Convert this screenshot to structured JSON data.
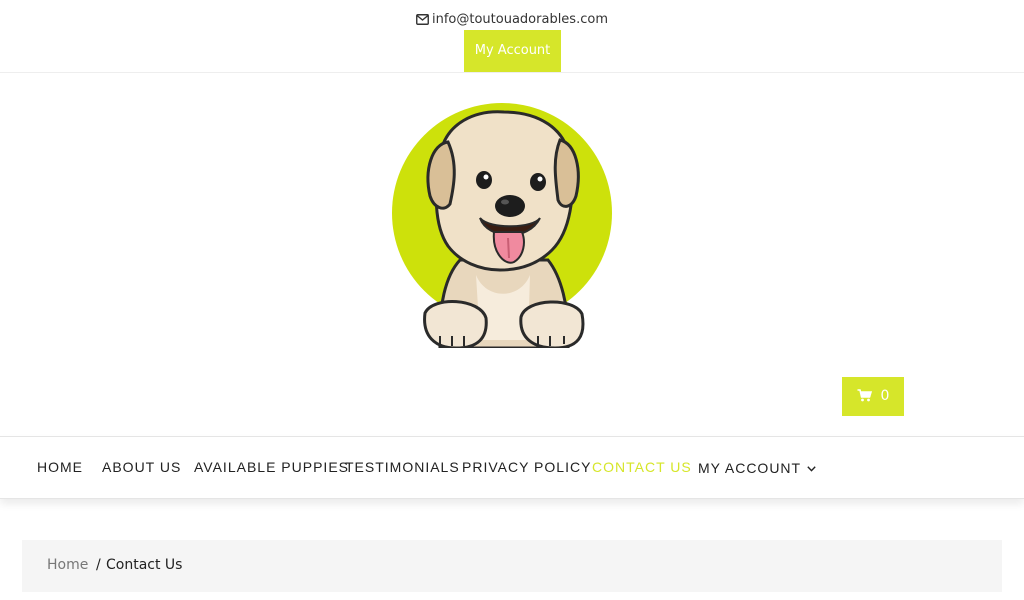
{
  "topbar": {
    "email": "info@toutouadorables.com",
    "account_label": "My Account"
  },
  "cart": {
    "count": "0"
  },
  "nav": {
    "items": [
      {
        "label": "HOME"
      },
      {
        "label": "ABOUT US"
      },
      {
        "label": "AVAILABLE PUPPIES"
      },
      {
        "label": "TESTIMONIALS"
      },
      {
        "label": "PRIVACY POLICY"
      },
      {
        "label": "CONTACT US"
      },
      {
        "label": "MY ACCOUNT"
      }
    ],
    "active": "CONTACT US"
  },
  "breadcrumb": {
    "home": "Home",
    "separator": "/",
    "current": "Contact Us"
  },
  "colors": {
    "accent": "#d6e62a",
    "nav_text": "#222222",
    "breadcrumb_bg": "#f5f5f5"
  },
  "icons": [
    "envelope-icon",
    "cart-icon",
    "chevron-down-icon",
    "puppy-logo"
  ]
}
